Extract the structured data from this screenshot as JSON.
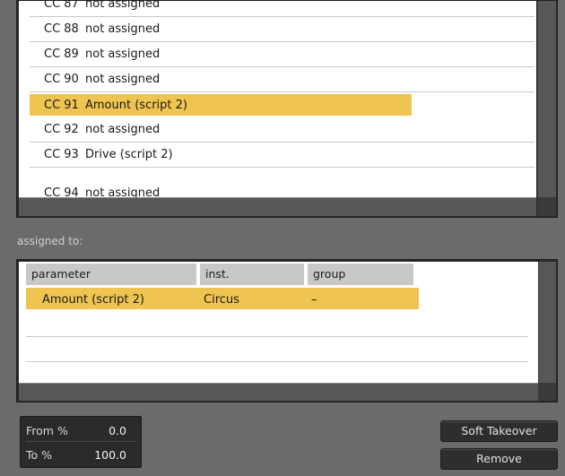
{
  "cc_list": {
    "rows": [
      {
        "cc": "CC 87",
        "name": "not assigned",
        "selected": false
      },
      {
        "cc": "CC 88",
        "name": "not assigned",
        "selected": false
      },
      {
        "cc": "CC 89",
        "name": "not assigned",
        "selected": false
      },
      {
        "cc": "CC 90",
        "name": "not assigned",
        "selected": false
      },
      {
        "cc": "CC 91",
        "name": "Amount (script 2)",
        "selected": true
      },
      {
        "cc": "CC 92",
        "name": "not assigned",
        "selected": false
      },
      {
        "cc": "CC 93",
        "name": "Drive (script 2)",
        "selected": false
      },
      {
        "cc": "CC 94",
        "name": "not assigned",
        "selected": false
      }
    ]
  },
  "assigned": {
    "label": "assigned to:",
    "columns": [
      "parameter",
      "inst.",
      "group"
    ],
    "rows": [
      {
        "parameter": "Amount (script 2)",
        "inst": "Circus",
        "group": "–",
        "selected": true
      }
    ]
  },
  "range": {
    "from_label": "From %",
    "from_value": "0.0",
    "to_label": "To %",
    "to_value": "100.0"
  },
  "buttons": {
    "soft_takeover": "Soft Takeover",
    "remove": "Remove"
  },
  "colors": {
    "selection": "#f0c451",
    "background": "#6b6b6b",
    "panel_dark": "#2a2a2a"
  }
}
